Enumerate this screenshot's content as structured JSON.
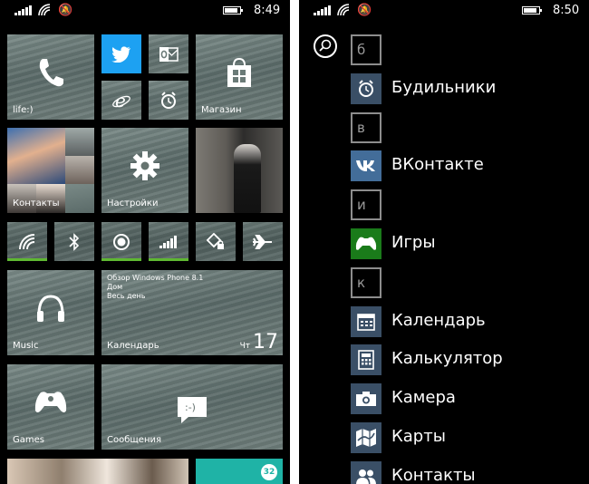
{
  "left_phone": {
    "status": {
      "time": "8:49"
    },
    "tiles": {
      "phone": "life:)",
      "store": "Магазин",
      "contacts": "Контакты",
      "settings": "Настройки",
      "music": "Music",
      "calendar": {
        "label": "Календарь",
        "event_title": "Обзор Windows Phone 8.1",
        "event_location": "Дом",
        "event_time": "Весь день",
        "day": "Чт",
        "date": "17"
      },
      "games": "Games",
      "messages": "Сообщения",
      "badge_count": "32"
    },
    "colors": {
      "twitter": "#1da1f2",
      "toggle_active": "#5fb832",
      "store_tile": "#1fb3a6"
    }
  },
  "right_phone": {
    "status": {
      "time": "8:50"
    },
    "letters": {
      "b": "б",
      "v": "в",
      "i": "и",
      "k": "к"
    },
    "apps": {
      "alarms": "Будильники",
      "vk": "ВКонтакте",
      "games": "Игры",
      "calendar": "Календарь",
      "calculator": "Калькулятор",
      "camera": "Камера",
      "maps": "Карты",
      "contacts": "Контакты"
    },
    "colors": {
      "icon_bg": "#3a4f66",
      "vk_bg": "#436d99",
      "games_bg": "#1a7b1a"
    }
  }
}
